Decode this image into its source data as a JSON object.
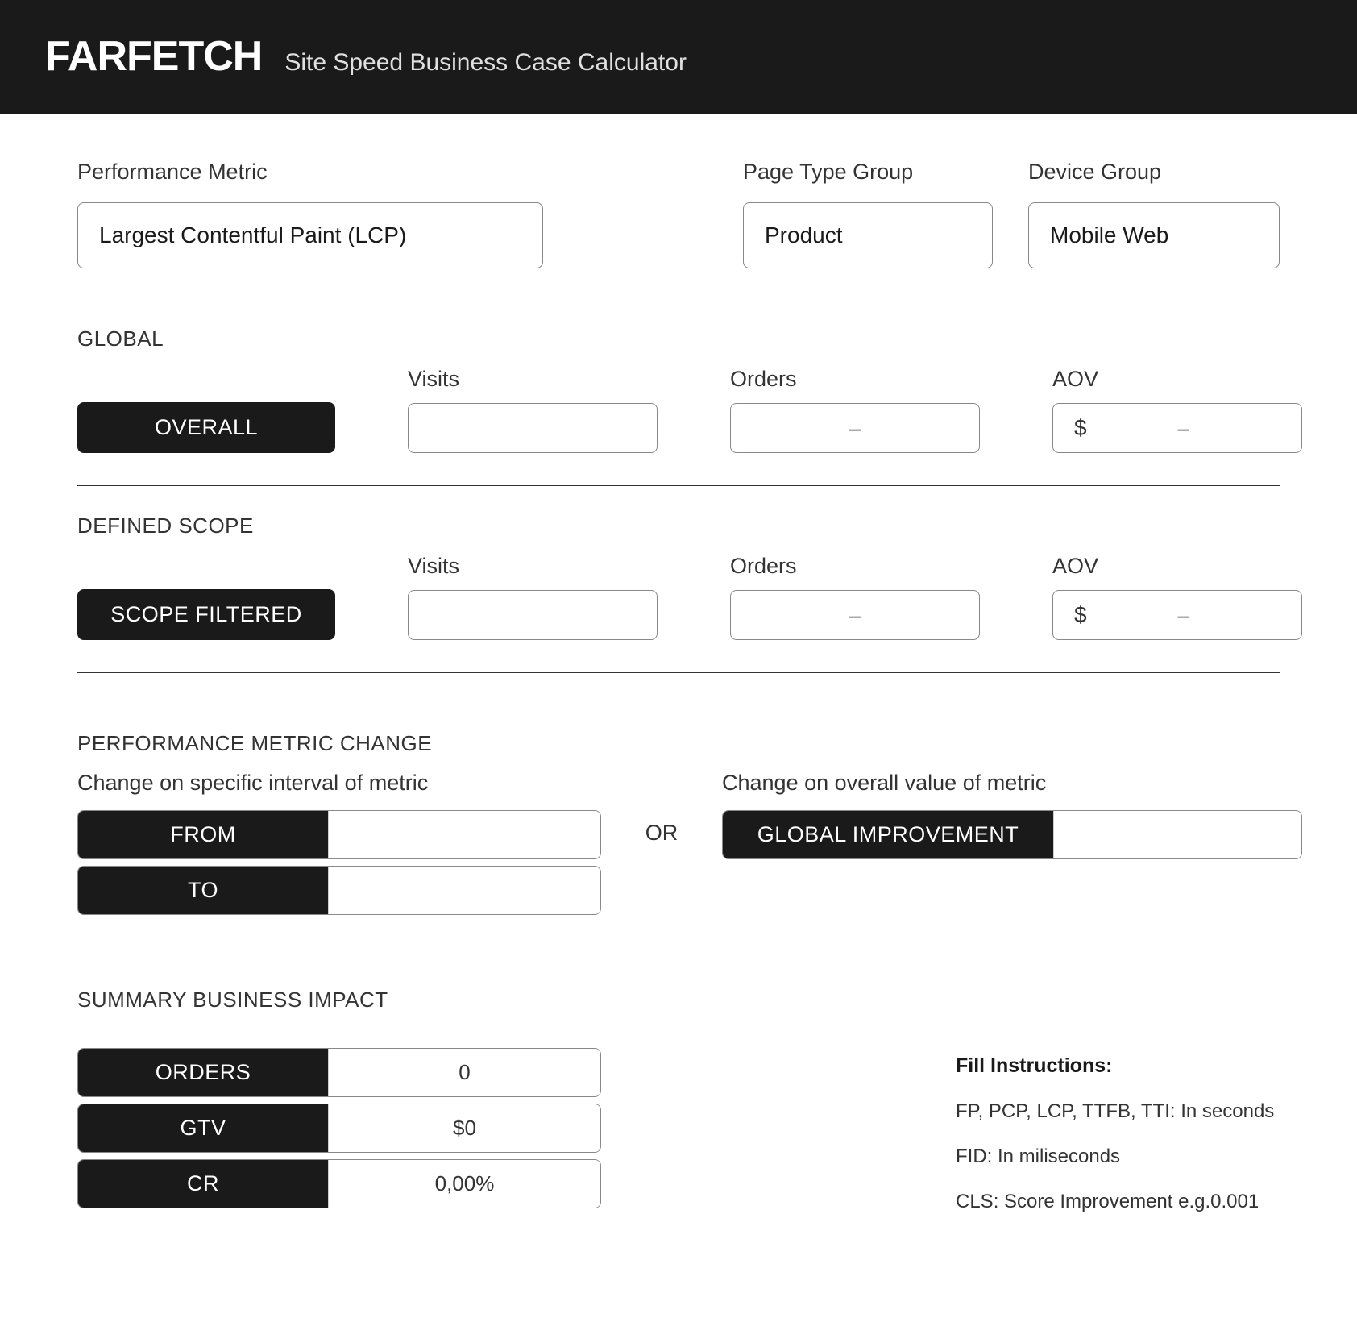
{
  "header": {
    "logo": "FARFETCH",
    "subtitle": "Site Speed Business Case Calculator"
  },
  "filters": {
    "metric_label": "Performance Metric",
    "metric_value": "Largest Contentful Paint (LCP)",
    "pagetype_label": "Page Type Group",
    "pagetype_value": "Product",
    "device_label": "Device Group",
    "device_value": "Mobile Web"
  },
  "global": {
    "section": "GLOBAL",
    "row_label": "OVERALL",
    "cols": {
      "visits": "Visits",
      "orders": "Orders",
      "aov": "AOV"
    },
    "visits": "",
    "orders": "–",
    "aov_currency": "$",
    "aov_value": "–"
  },
  "scope": {
    "section": "DEFINED SCOPE",
    "row_label": "SCOPE FILTERED",
    "cols": {
      "visits": "Visits",
      "orders": "Orders",
      "aov": "AOV"
    },
    "visits": "",
    "orders": "–",
    "aov_currency": "$",
    "aov_value": "–"
  },
  "change": {
    "section": "PERFORMANCE METRIC CHANGE",
    "left_label": "Change on specific interval of metric",
    "right_label": "Change on overall value of metric",
    "or": "OR",
    "from_label": "FROM",
    "to_label": "TO",
    "from_value": "",
    "to_value": "",
    "global_label": "GLOBAL IMPROVEMENT",
    "global_value": ""
  },
  "summary": {
    "section": "SUMMARY BUSINESS IMPACT",
    "rows": {
      "orders_label": "ORDERS",
      "orders_value": "0",
      "gtv_label": "GTV",
      "gtv_value": "$0",
      "cr_label": "CR",
      "cr_value": "0,00%"
    }
  },
  "instructions": {
    "title": "Fill Instructions:",
    "line1": "FP, PCP, LCP, TTFB, TTI: In seconds",
    "line2": "FID: In miliseconds",
    "line3": "CLS: Score Improvement e.g.0.001"
  }
}
